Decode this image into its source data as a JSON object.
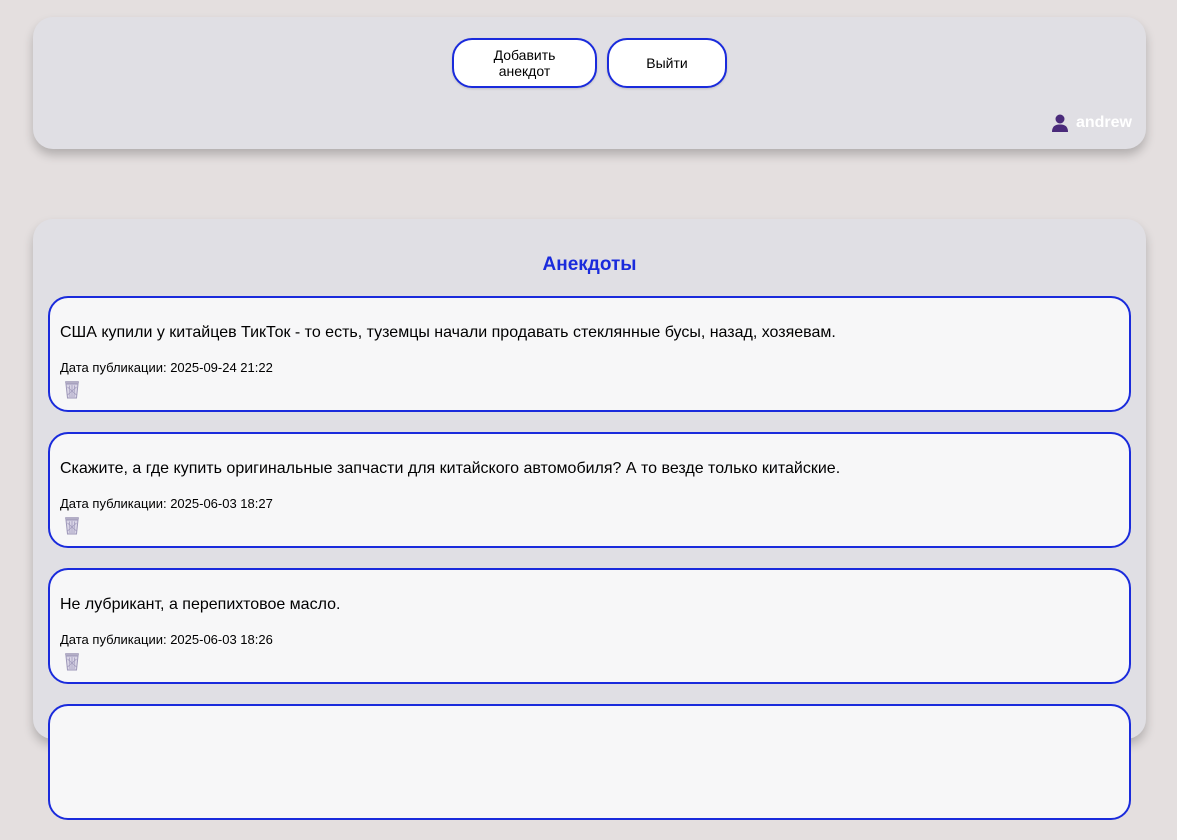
{
  "header": {
    "add_label": "Добавить анекдот",
    "exit_label": "Выйти",
    "user": {
      "name": "andrew",
      "icon": "user-icon",
      "icon_color": "#4a2a7a"
    }
  },
  "jokes_section": {
    "title": "Анекдоты",
    "items": [
      {
        "text": "США купили у китайцев ТикТок - то есть, туземцы начали продавать стеклянные бусы, назад, хозяевам.",
        "date": "Дата публикации: 2025-09-24 21:22",
        "delete_icon": "trash-icon"
      },
      {
        "text": "Скажите, а где купить оригинальные запчасти для китайского автомобиля? А то везде только китайские.",
        "date": "Дата публикации: 2025-06-03 18:27",
        "delete_icon": "trash-icon"
      },
      {
        "text": "Не лубрикант, а перепихтовое масло.",
        "date": "Дата публикации: 2025-06-03 18:26",
        "delete_icon": "trash-icon"
      },
      {
        "text": "",
        "date": "",
        "delete_icon": "trash-icon"
      }
    ]
  },
  "colors": {
    "accent": "#1a2bdc",
    "page_bg": "#e4dfdf",
    "panel_bg": "#e0dfe4",
    "card_bg": "#f7f7f8"
  }
}
